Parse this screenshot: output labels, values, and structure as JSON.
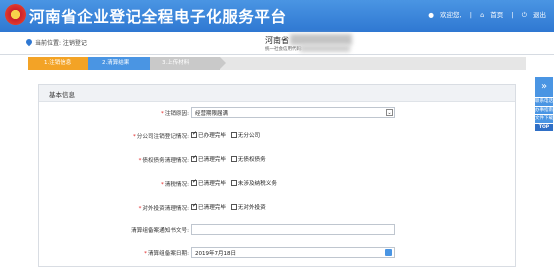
{
  "header": {
    "title": "河南省企业登记全程电子化服务平台",
    "welcome": "欢迎您,",
    "nav": [
      "首页",
      "退出"
    ]
  },
  "location": {
    "text": "当前位置: 注销登记",
    "enterprise_name": "河南省",
    "credit_code_label": "统一社会信用代码:"
  },
  "steps": [
    "1.注销信息",
    "2.清算结果",
    "3.上传材料"
  ],
  "panel": {
    "title": "基本信息",
    "rows": [
      {
        "label": "注销原因:",
        "type": "select",
        "value": "经营期限届满"
      },
      {
        "label": "分公司注销登记情况:",
        "type": "checks",
        "options": [
          "已办理完毕",
          "无分公司"
        ],
        "checked": [
          true,
          false
        ]
      },
      {
        "label": "债权债务清理情况:",
        "type": "checks",
        "options": [
          "已清理完毕",
          "无债权债务"
        ],
        "checked": [
          true,
          false
        ]
      },
      {
        "label": "清税情况:",
        "type": "checks",
        "options": [
          "已清理完毕",
          "未涉及纳税义务"
        ],
        "checked": [
          true,
          false
        ]
      },
      {
        "label": "对外投资清理情况:",
        "type": "checks",
        "options": [
          "已清理完毕",
          "无对外投资"
        ],
        "checked": [
          true,
          false
        ]
      },
      {
        "label": "清算组备案通知书文号:",
        "type": "input",
        "value": ""
      },
      {
        "label": "清算组备案日期:",
        "type": "date",
        "value": "2019年7月18日"
      }
    ]
  },
  "float_menu": [
    "联系电话",
    "办事指南",
    "文件下载",
    "TOP"
  ],
  "colors": {
    "primary": "#2f78d2",
    "step_active": "#f3a326",
    "required": "#e02020"
  }
}
